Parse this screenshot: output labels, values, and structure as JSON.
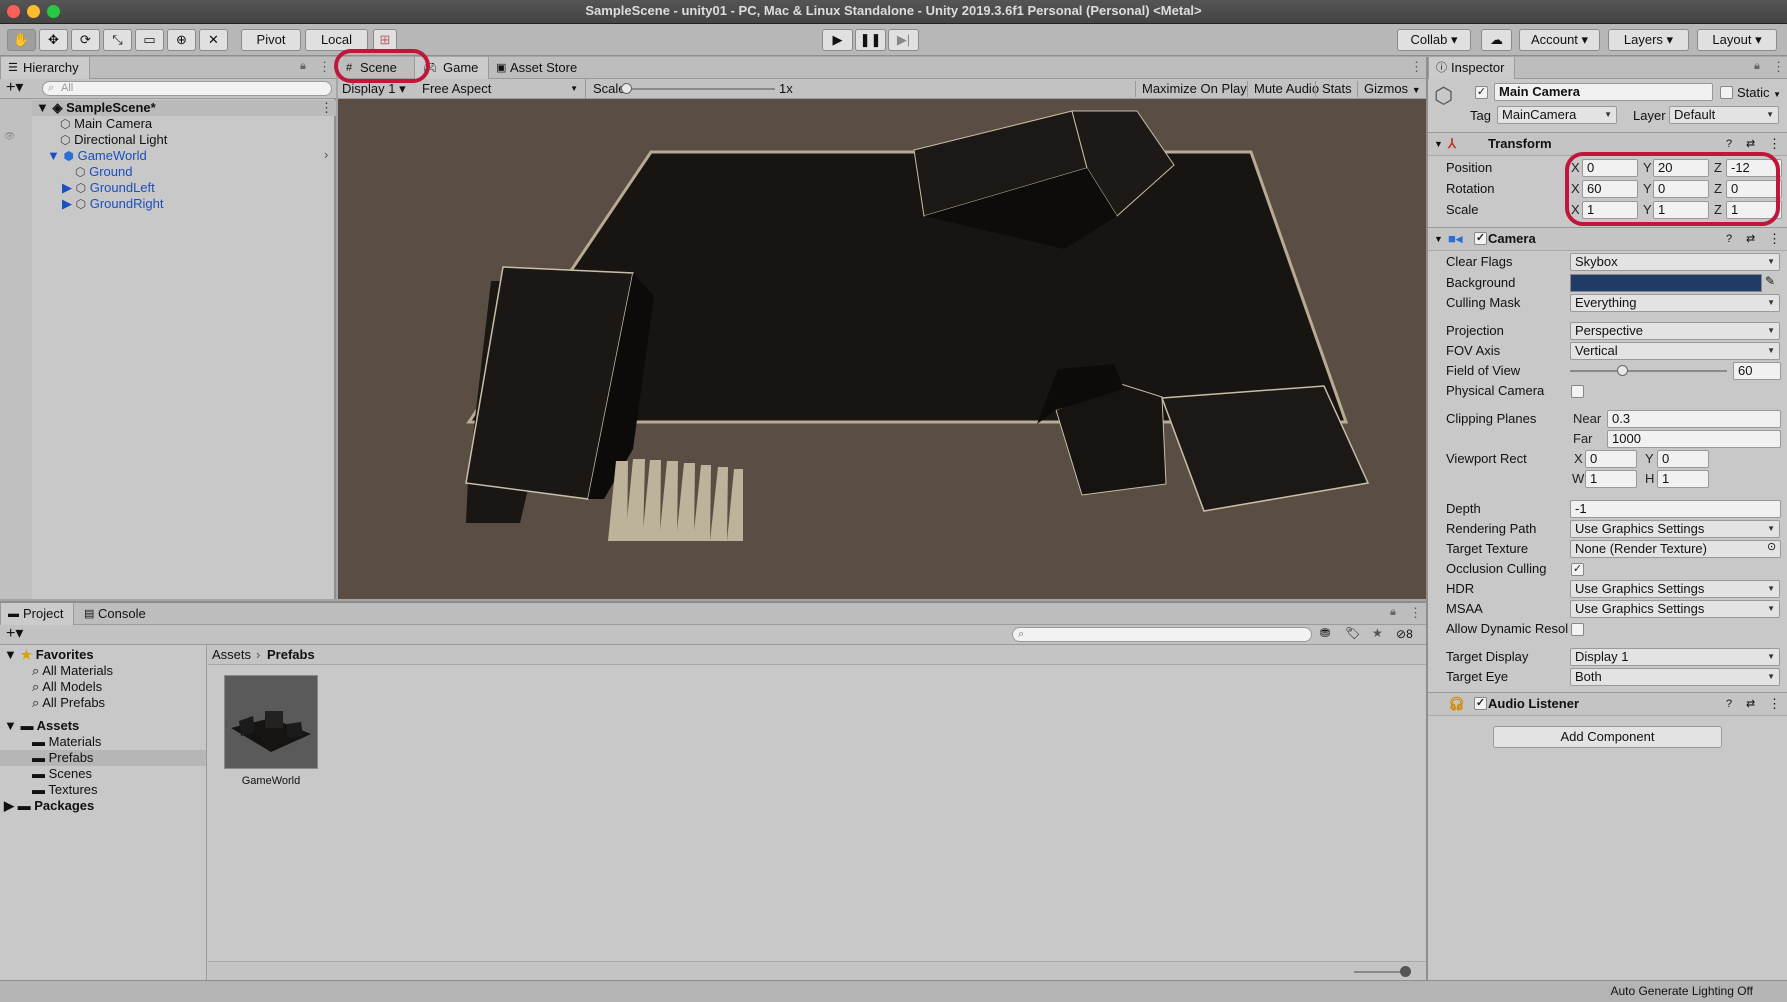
{
  "title_bar": {
    "title": "SampleScene - unity01 - PC, Mac & Linux Standalone - Unity 2019.3.6f1 Personal (Personal) <Metal>"
  },
  "toolbar": {
    "tools": [
      "hand-icon",
      "move-icon",
      "rotate-icon",
      "scale-icon",
      "rect-tool-icon",
      "transform-tool-icon",
      "custom-tool-icon"
    ],
    "pivot_label": "Pivot",
    "local_label": "Local",
    "collab_label": "Collab",
    "account_label": "Account",
    "layers_label": "Layers",
    "layout_label": "Layout"
  },
  "hierarchy": {
    "tab_label": "Hierarchy",
    "search_placeholder": "All",
    "items": [
      {
        "label": "SampleScene*"
      },
      {
        "label": "Main Camera"
      },
      {
        "label": "Directional Light"
      },
      {
        "label": "GameWorld"
      },
      {
        "label": "Ground"
      },
      {
        "label": "GroundLeft"
      },
      {
        "label": "GroundRight"
      }
    ]
  },
  "center": {
    "tabs": [
      {
        "label": "Scene"
      },
      {
        "label": "Game"
      },
      {
        "label": "Asset Store"
      }
    ],
    "display_label": "Display 1",
    "aspect_label": "Free Aspect",
    "scale_label": "Scale",
    "scale_value": "1x",
    "maximize_label": "Maximize On Play",
    "mute_label": "Mute Audio",
    "stats_label": "Stats",
    "gizmos_label": "Gizmos"
  },
  "project": {
    "tabs": [
      {
        "label": "Project"
      },
      {
        "label": "Console"
      }
    ],
    "hidden_count": "8",
    "favorites_label": "Favorites",
    "favorites": [
      "All Materials",
      "All Models",
      "All Prefabs"
    ],
    "assets_label": "Assets",
    "asset_folders": [
      "Materials",
      "Prefabs",
      "Scenes",
      "Textures"
    ],
    "packages_label": "Packages",
    "breadcrumb": [
      "Assets",
      "Prefabs"
    ],
    "asset_item_label": "GameWorld"
  },
  "inspector": {
    "tab_label": "Inspector",
    "object_name": "Main Camera",
    "static_label": "Static",
    "tag_label": "Tag",
    "tag_value": "MainCamera",
    "layer_label": "Layer",
    "layer_value": "Default",
    "transform": {
      "title": "Transform",
      "position_label": "Position",
      "position": {
        "x": "0",
        "y": "20",
        "z": "-12"
      },
      "rotation_label": "Rotation",
      "rotation": {
        "x": "60",
        "y": "0",
        "z": "0"
      },
      "scale_label": "Scale",
      "scale": {
        "x": "1",
        "y": "1",
        "z": "1"
      }
    },
    "camera": {
      "title": "Camera",
      "clear_flags_label": "Clear Flags",
      "clear_flags": "Skybox",
      "background_label": "Background",
      "background_color": "#1f3b66",
      "culling_mask_label": "Culling Mask",
      "culling_mask": "Everything",
      "projection_label": "Projection",
      "projection": "Perspective",
      "fov_axis_label": "FOV Axis",
      "fov_axis": "Vertical",
      "fov_label": "Field of View",
      "fov": "60",
      "fov_min": 1,
      "fov_max": 179,
      "physical_label": "Physical Camera",
      "clipping_label": "Clipping Planes",
      "near_label": "Near",
      "near": "0.3",
      "far_label": "Far",
      "far": "1000",
      "viewport_label": "Viewport Rect",
      "vp_x": "0",
      "vp_y": "0",
      "vp_w": "1",
      "vp_h": "1",
      "depth_label": "Depth",
      "depth": "-1",
      "rendering_path_label": "Rendering Path",
      "rendering_path": "Use Graphics Settings",
      "target_texture_label": "Target Texture",
      "target_texture": "None (Render Texture)",
      "occlusion_label": "Occlusion Culling",
      "hdr_label": "HDR",
      "hdr": "Use Graphics Settings",
      "msaa_label": "MSAA",
      "msaa": "Use Graphics Settings",
      "dynamic_res_label": "Allow Dynamic Resolu",
      "target_display_label": "Target Display",
      "target_display": "Display 1",
      "target_eye_label": "Target Eye",
      "target_eye": "Both"
    },
    "audio_listener": {
      "title": "Audio Listener"
    },
    "add_component_label": "Add Component"
  },
  "status_bar": {
    "text": "Auto Generate Lighting Off"
  },
  "colors": {
    "highlight_ring": "#c0163b",
    "game_bg": "#5a4e44",
    "accent_blue": "#1a4fbf"
  }
}
